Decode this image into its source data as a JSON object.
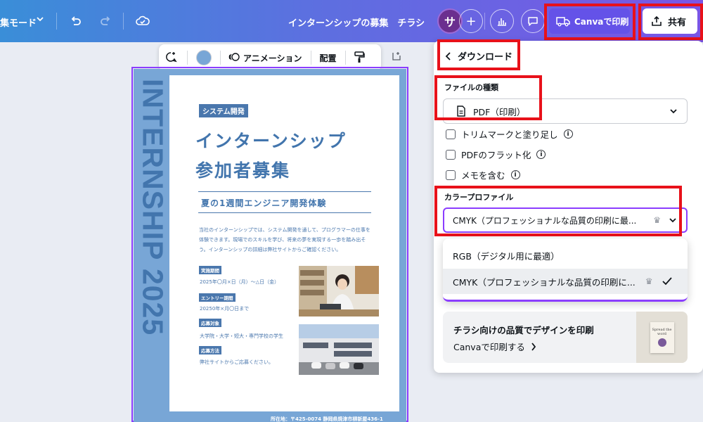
{
  "topbar": {
    "mode_label": "集モード",
    "design_title": "インターンシップの募集　チラシ",
    "avatar_initial": "サ",
    "print_label": "Canvaで印刷",
    "share_label": "共有"
  },
  "floating_toolbar": {
    "animation_label": "アニメーション",
    "position_label": "配置"
  },
  "poster": {
    "vertical_text": "INTERNSHIP 2025",
    "badge": "システム開発",
    "title_line1": "インターンシップ",
    "title_line2": "参加者募集",
    "subtitle": "夏の1週間エンジニア開発体験",
    "body": "当社のインターンシップでは、システム開発を通して、プログラマーの仕事を体験できます。現場でのスキルを学び、将来の夢を実現する一歩を踏み出そう。インターンシップの詳細は弊社サイトからご確認ください。",
    "items": [
      {
        "label": "実施期間",
        "value": "2025年〇月×日（月）～△日（金）"
      },
      {
        "label": "エントリー期間",
        "value": "20250年×月〇日まで"
      },
      {
        "label": "応募対象",
        "value": "大学院・大学・短大・専門学校の学生"
      },
      {
        "label": "応募方法",
        "value": "弊社サイトからご応募ください。"
      }
    ],
    "footer": "所在地：〒425-0074 静岡県焼津市柳新屋436-1"
  },
  "panel": {
    "back_label": "ダウンロード",
    "file_type_heading": "ファイルの種類",
    "file_type_value": "PDF（印刷）",
    "options": [
      {
        "label": "トリムマークと塗り足し"
      },
      {
        "label": "PDFのフラット化"
      },
      {
        "label": "メモを含む"
      }
    ],
    "color_profile_heading": "カラープロファイル",
    "color_profile_value": "CMYK（プロフェッショナルな品質の印刷に最...",
    "dropdown_options": [
      {
        "label": "RGB（デジタル用に最適）"
      },
      {
        "label": "CMYK（プロフェッショナルな品質の印刷に..."
      }
    ],
    "promo_title": "チラシ向けの品質でデザインを印刷",
    "promo_link": "Canvaで印刷する",
    "promo_book_text": "Spread the word"
  }
}
